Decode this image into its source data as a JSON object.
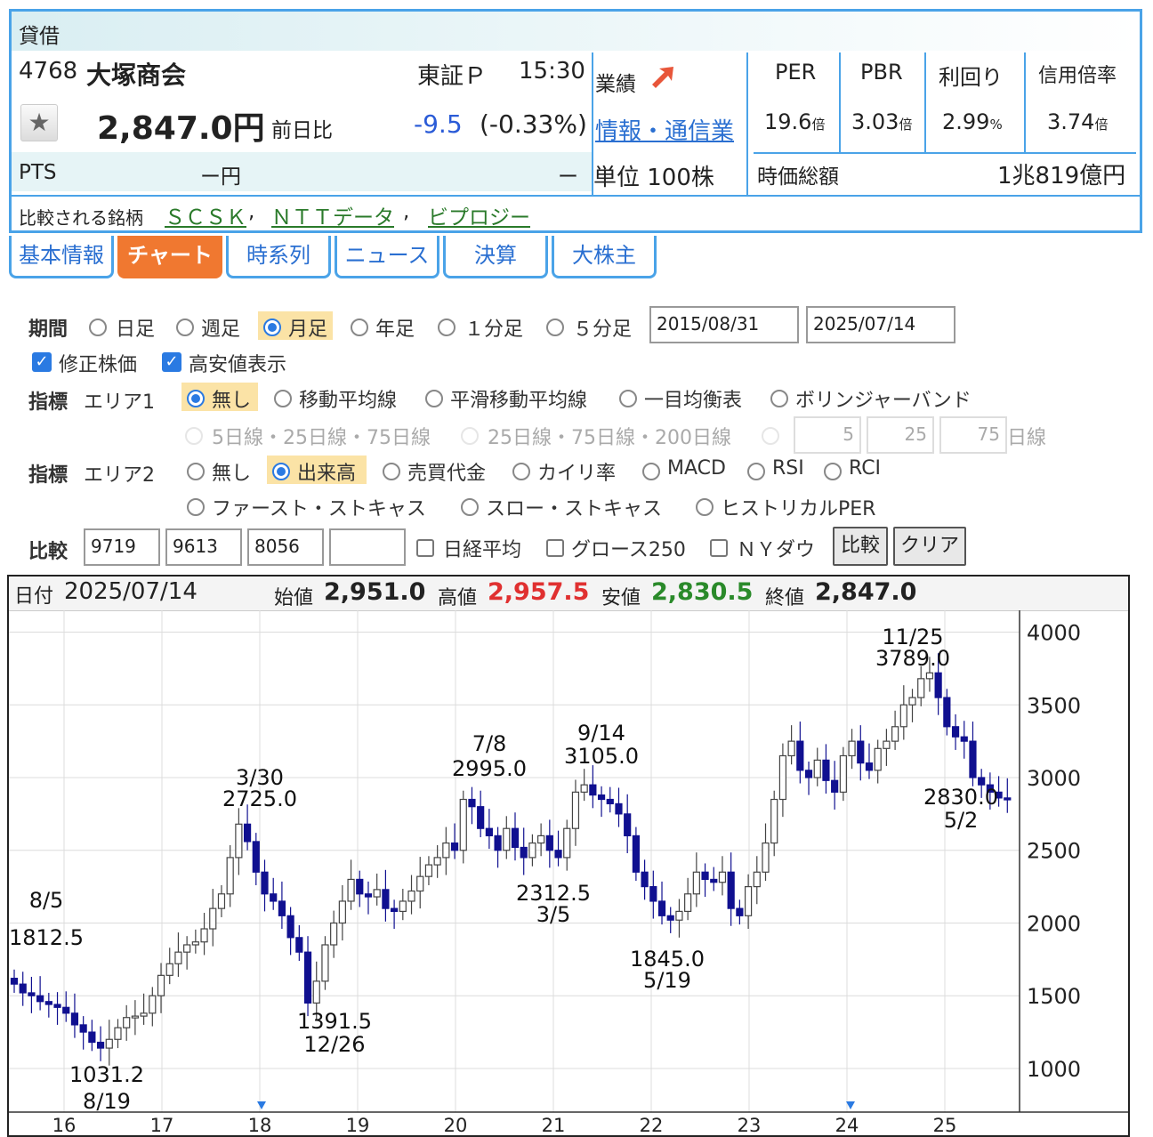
{
  "header": {
    "section_label": "貸借",
    "code": "4768",
    "name": "大塚商会",
    "market": "東証Ｐ",
    "time": "15:30",
    "price": "2,847.0円",
    "change_label": "前日比",
    "change": "-9.5",
    "change_pct": "(-0.33%)",
    "pts_label": "PTS",
    "pts_price": "ー円",
    "pts_change": "ー",
    "gyoseki_label": "業績",
    "sector": "情報・通信業",
    "unit": "単位 100株",
    "metrics": [
      {
        "label": "PER",
        "value": "19.6",
        "unit": "倍"
      },
      {
        "label": "PBR",
        "value": "3.03",
        "unit": "倍"
      },
      {
        "label": "利回り",
        "value": "2.99",
        "unit": "%"
      },
      {
        "label": "信用倍率",
        "value": "3.74",
        "unit": "倍"
      }
    ],
    "mcap_label": "時価総額",
    "mcap_value": "1兆819億円",
    "compare_label": "比較される銘柄",
    "compare": [
      "ＳＣＳＫ",
      "ＮＴＴデータ",
      "ビプロジー"
    ]
  },
  "tabs": [
    "基本情報",
    "チャート",
    "時系列",
    "ニュース",
    "決算",
    "大株主"
  ],
  "active_tab": "チャート",
  "form": {
    "period_label": "期間",
    "periods": [
      "日足",
      "週足",
      "月足",
      "年足",
      "１分足",
      "５分足"
    ],
    "selected_period": "月足",
    "date_from": "2015/08/31",
    "date_to": "2025/07/14",
    "adjusted_label": "修正株価",
    "highlow_label": "高安値表示",
    "ind_label": "指標",
    "area1_label": "エリア1",
    "area1_options": [
      "無し",
      "移動平均線",
      "平滑移動平均線",
      "一目均衡表",
      "ボリンジャーバンド"
    ],
    "area1_selected": "無し",
    "ma_options": [
      "5日線・25日線・75日線",
      "25日線・75日線・200日線"
    ],
    "ma_inputs": [
      "5",
      "25",
      "75"
    ],
    "ma_unit": "日線",
    "area2_label": "エリア2",
    "area2_options": [
      "無し",
      "出来高",
      "売買代金",
      "カイリ率",
      "MACD",
      "RSI",
      "RCI",
      "ファースト・ストキャス",
      "スロー・ストキャス",
      "ヒストリカルPER"
    ],
    "area2_selected": "出来高",
    "compare_label": "比較",
    "compare_codes": [
      "9719",
      "9613",
      "8056",
      ""
    ],
    "compare_checks": [
      "日経平均",
      "グロース250",
      "ＮＹダウ"
    ],
    "compare_button": "比較",
    "clear_button": "クリア"
  },
  "ohlc_bar": {
    "date_label": "日付",
    "date": "2025/07/14",
    "open_label": "始値",
    "open": "2,951.0",
    "high_label": "高値",
    "high": "2,957.5",
    "low_label": "安値",
    "low": "2,830.5",
    "close_label": "終値",
    "close": "2,847.0"
  },
  "chart_data": {
    "type": "candlestick",
    "y_ticks": [
      1000,
      1500,
      2000,
      2500,
      3000,
      3500,
      4000
    ],
    "ylim": [
      700,
      4150
    ],
    "x_ticks": [
      "16",
      "17",
      "18",
      "19",
      "20",
      "21",
      "22",
      "23",
      "24",
      "25"
    ],
    "annotations": [
      {
        "date": "8/5",
        "value": "1812.5"
      },
      {
        "date": "8/19",
        "value": "1031.2"
      },
      {
        "date": "3/30",
        "value": "2725.0"
      },
      {
        "date": "12/26",
        "value": "1391.5"
      },
      {
        "date": "7/8",
        "value": "2995.0"
      },
      {
        "date": "3/5",
        "value": "2312.5"
      },
      {
        "date": "9/14",
        "value": "3105.0"
      },
      {
        "date": "5/19",
        "value": "1845.0"
      },
      {
        "date": "11/25",
        "value": "3789.0"
      },
      {
        "date": "5/2",
        "value": "2830.0"
      }
    ],
    "close_series": [
      1580,
      1520,
      1500,
      1460,
      1440,
      1420,
      1380,
      1300,
      1250,
      1180,
      1140,
      1200,
      1280,
      1350,
      1360,
      1380,
      1500,
      1640,
      1720,
      1800,
      1850,
      1870,
      1960,
      2100,
      2200,
      2450,
      2680,
      2560,
      2350,
      2200,
      2150,
      2050,
      1900,
      1800,
      1450,
      1600,
      1850,
      2000,
      2150,
      2300,
      2200,
      2180,
      2230,
      2100,
      2080,
      2150,
      2220,
      2320,
      2400,
      2450,
      2550,
      2500,
      2850,
      2800,
      2650,
      2600,
      2500,
      2650,
      2520,
      2450,
      2550,
      2600,
      2500,
      2450,
      2650,
      2900,
      2950,
      2880,
      2850,
      2820,
      2750,
      2600,
      2350,
      2250,
      2150,
      2050,
      2020,
      2080,
      2200,
      2350,
      2300,
      2280,
      2350,
      2100,
      2050,
      2250,
      2350,
      2550,
      2850,
      3150,
      3250,
      3050,
      3000,
      3120,
      2980,
      2900,
      3150,
      3250,
      3100,
      3050,
      3200,
      3250,
      3350,
      3500,
      3550,
      3680,
      3720,
      3550,
      3350,
      3280,
      3250,
      3000,
      2950,
      2900,
      2860,
      2847
    ]
  }
}
